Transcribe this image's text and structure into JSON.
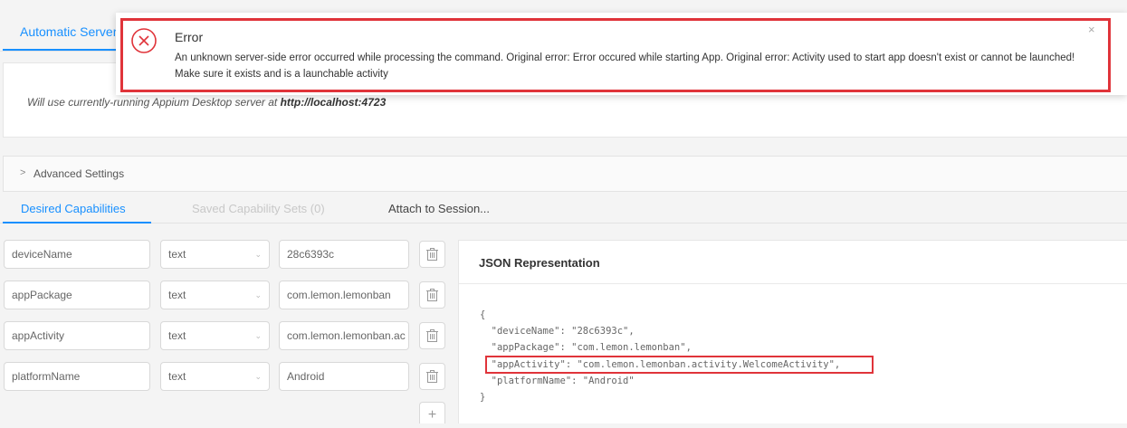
{
  "server_tabs": {
    "active": "Automatic Server"
  },
  "server_panel": {
    "note_prefix": "Will use currently-running Appium Desktop server at ",
    "server_url": "http://localhost:4723"
  },
  "advanced": {
    "chevron": ">",
    "label": "Advanced Settings"
  },
  "cap_tabs": {
    "desired": "Desired Capabilities",
    "saved": "Saved Capability Sets (0)",
    "attach": "Attach to Session..."
  },
  "capabilities": [
    {
      "name": "deviceName",
      "type": "text",
      "value": "28c6393c"
    },
    {
      "name": "appPackage",
      "type": "text",
      "value": "com.lemon.lemonban"
    },
    {
      "name": "appActivity",
      "type": "text",
      "value": "com.lemon.lemonban.ac"
    },
    {
      "name": "platformName",
      "type": "text",
      "value": "Android"
    }
  ],
  "add_button": {
    "glyph": "+"
  },
  "json_panel": {
    "title": "JSON Representation",
    "lines": [
      "{",
      "  \"deviceName\": \"28c6393c\",",
      "  \"appPackage\": \"com.lemon.lemonban\",",
      "  \"appActivity\": \"com.lemon.lemonban.activity.WelcomeActivity\",",
      "  \"platformName\": \"Android\"",
      "}"
    ]
  },
  "error": {
    "title": "Error",
    "message": "An unknown server-side error occurred while processing the command. Original error: Error occured while starting App. Original error: Activity used to start app doesn't exist or cannot be launched! Make sure it exists and is a launchable activity",
    "close": "×"
  },
  "colors": {
    "accent": "#1890ff",
    "error": "#e0343a"
  }
}
